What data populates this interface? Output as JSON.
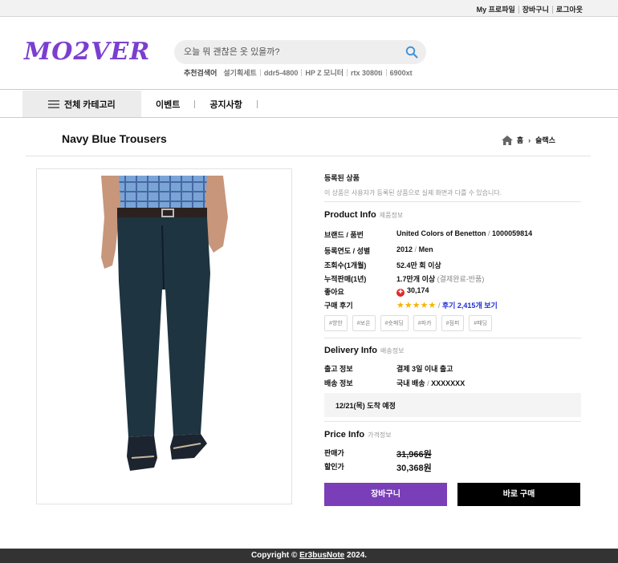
{
  "topbar": {
    "links": [
      "My 프로파일",
      "장바구니",
      "로그아웃"
    ]
  },
  "brand": {
    "logo_text": "MO2VER",
    "accent": "#7a3fd1"
  },
  "search": {
    "placeholder": "오늘 뭐 괜찮은 옷 있을까?",
    "recommend_label": "추천검색어",
    "keywords": [
      "설기획세트",
      "ddr5-4800",
      "HP Z 모니터",
      "rtx 3080ti",
      "6900xt"
    ],
    "icon": "search-icon"
  },
  "nav": {
    "all_categories": "전체 카테고리",
    "menu": [
      "이벤트",
      "공지사항"
    ]
  },
  "page": {
    "title": "Navy Blue Trousers",
    "breadcrumb": {
      "home": "홈",
      "current": "슬랙스"
    }
  },
  "product": {
    "registered_title": "등록된 상품",
    "registered_desc": "이 상품은 사용자가 등록된 상품으로 실제 화면과 다를 수 있습니다.",
    "info_title": "Product Info",
    "info_sub": "제품정보",
    "rows": {
      "brand_key": "브랜드",
      "brand_key2": "품번",
      "brand_val": "United Colors of Benetton",
      "brand_val2": "1000059814",
      "year_key": "등록연도",
      "year_key2": "성별",
      "year_val": "2012",
      "year_val2": "Men",
      "views_key": "조회수(1개월)",
      "views_val": "52.4만 회 이상",
      "sales_key": "누적판매(1년)",
      "sales_val": "1.7만개 이상",
      "sales_note": "(결제완료-반품)",
      "likes_key": "좋아요",
      "likes_val": "30,174",
      "review_key": "구매 후기",
      "review_stars": "★★★★★",
      "review_rating": 5,
      "review_link": "후기 2,415개 보기"
    },
    "tags": [
      "#향한",
      "#보온",
      "#숏패딩",
      "#파카",
      "#점퍼",
      "#패딩"
    ],
    "delivery_title": "Delivery Info",
    "delivery_sub": "배송정보",
    "delivery": {
      "ship_key": "출고 정보",
      "ship_val": "결제 3일 이내 출고",
      "method_key": "배송 정보",
      "method_val": "국내 배송",
      "method_val2": "XXXXXXX"
    },
    "eta": "12/21(목) 도착 예정",
    "price_title": "Price Info",
    "price_sub": "가격정보",
    "price": {
      "orig_key": "판매가",
      "orig_val": "31,966원",
      "sale_key": "할인가",
      "sale_val": "30,368원"
    },
    "buttons": {
      "cart": "장바구니",
      "buy": "바로 구매"
    },
    "colors": {
      "cart": "#7a3fb8",
      "buy": "#000000",
      "like": "#e0292b",
      "stars": "#f5b400",
      "link": "#1f2fd3"
    }
  },
  "footer": {
    "prefix": "Copyright ©",
    "author": "Er3busNote",
    "year": "2024."
  }
}
